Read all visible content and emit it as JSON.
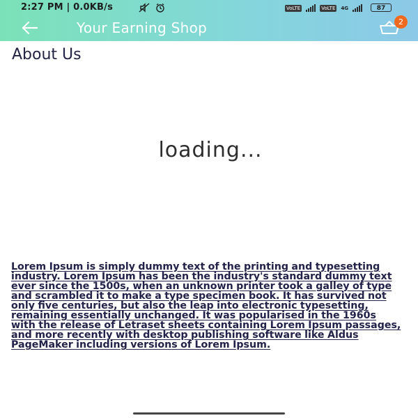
{
  "status_bar": {
    "time_label": "2:27 PM | 0.0KB/s",
    "sim1_label": "VoLTE",
    "sim2_label": "4G",
    "battery": "87"
  },
  "header": {
    "title": "Your Earning Shop",
    "cart_count": "2",
    "background_from": "#7be2b8",
    "background_to": "#8cc8e8",
    "badge_color": "#ef6a1f"
  },
  "page": {
    "title": "About Us",
    "loading_text": "loading...",
    "body_text": "Lorem Ipsum is simply dummy text of the printing and typesetting industry. Lorem Ipsum has been the industry's standard dummy text ever since the 1500s, when an unknown printer took a galley of type and scrambled it to make a type specimen book. It has survived not only five centuries, but also the leap into electronic typesetting, remaining essentially unchanged. It was popularised in the 1960s with the release of Letraset sheets containing Lorem Ipsum passages, and more recently with desktop publishing software like Aldus PageMaker including versions of Lorem Ipsum."
  },
  "icons": {
    "back": "arrow-left-icon",
    "cart": "shopping-basket-icon"
  }
}
